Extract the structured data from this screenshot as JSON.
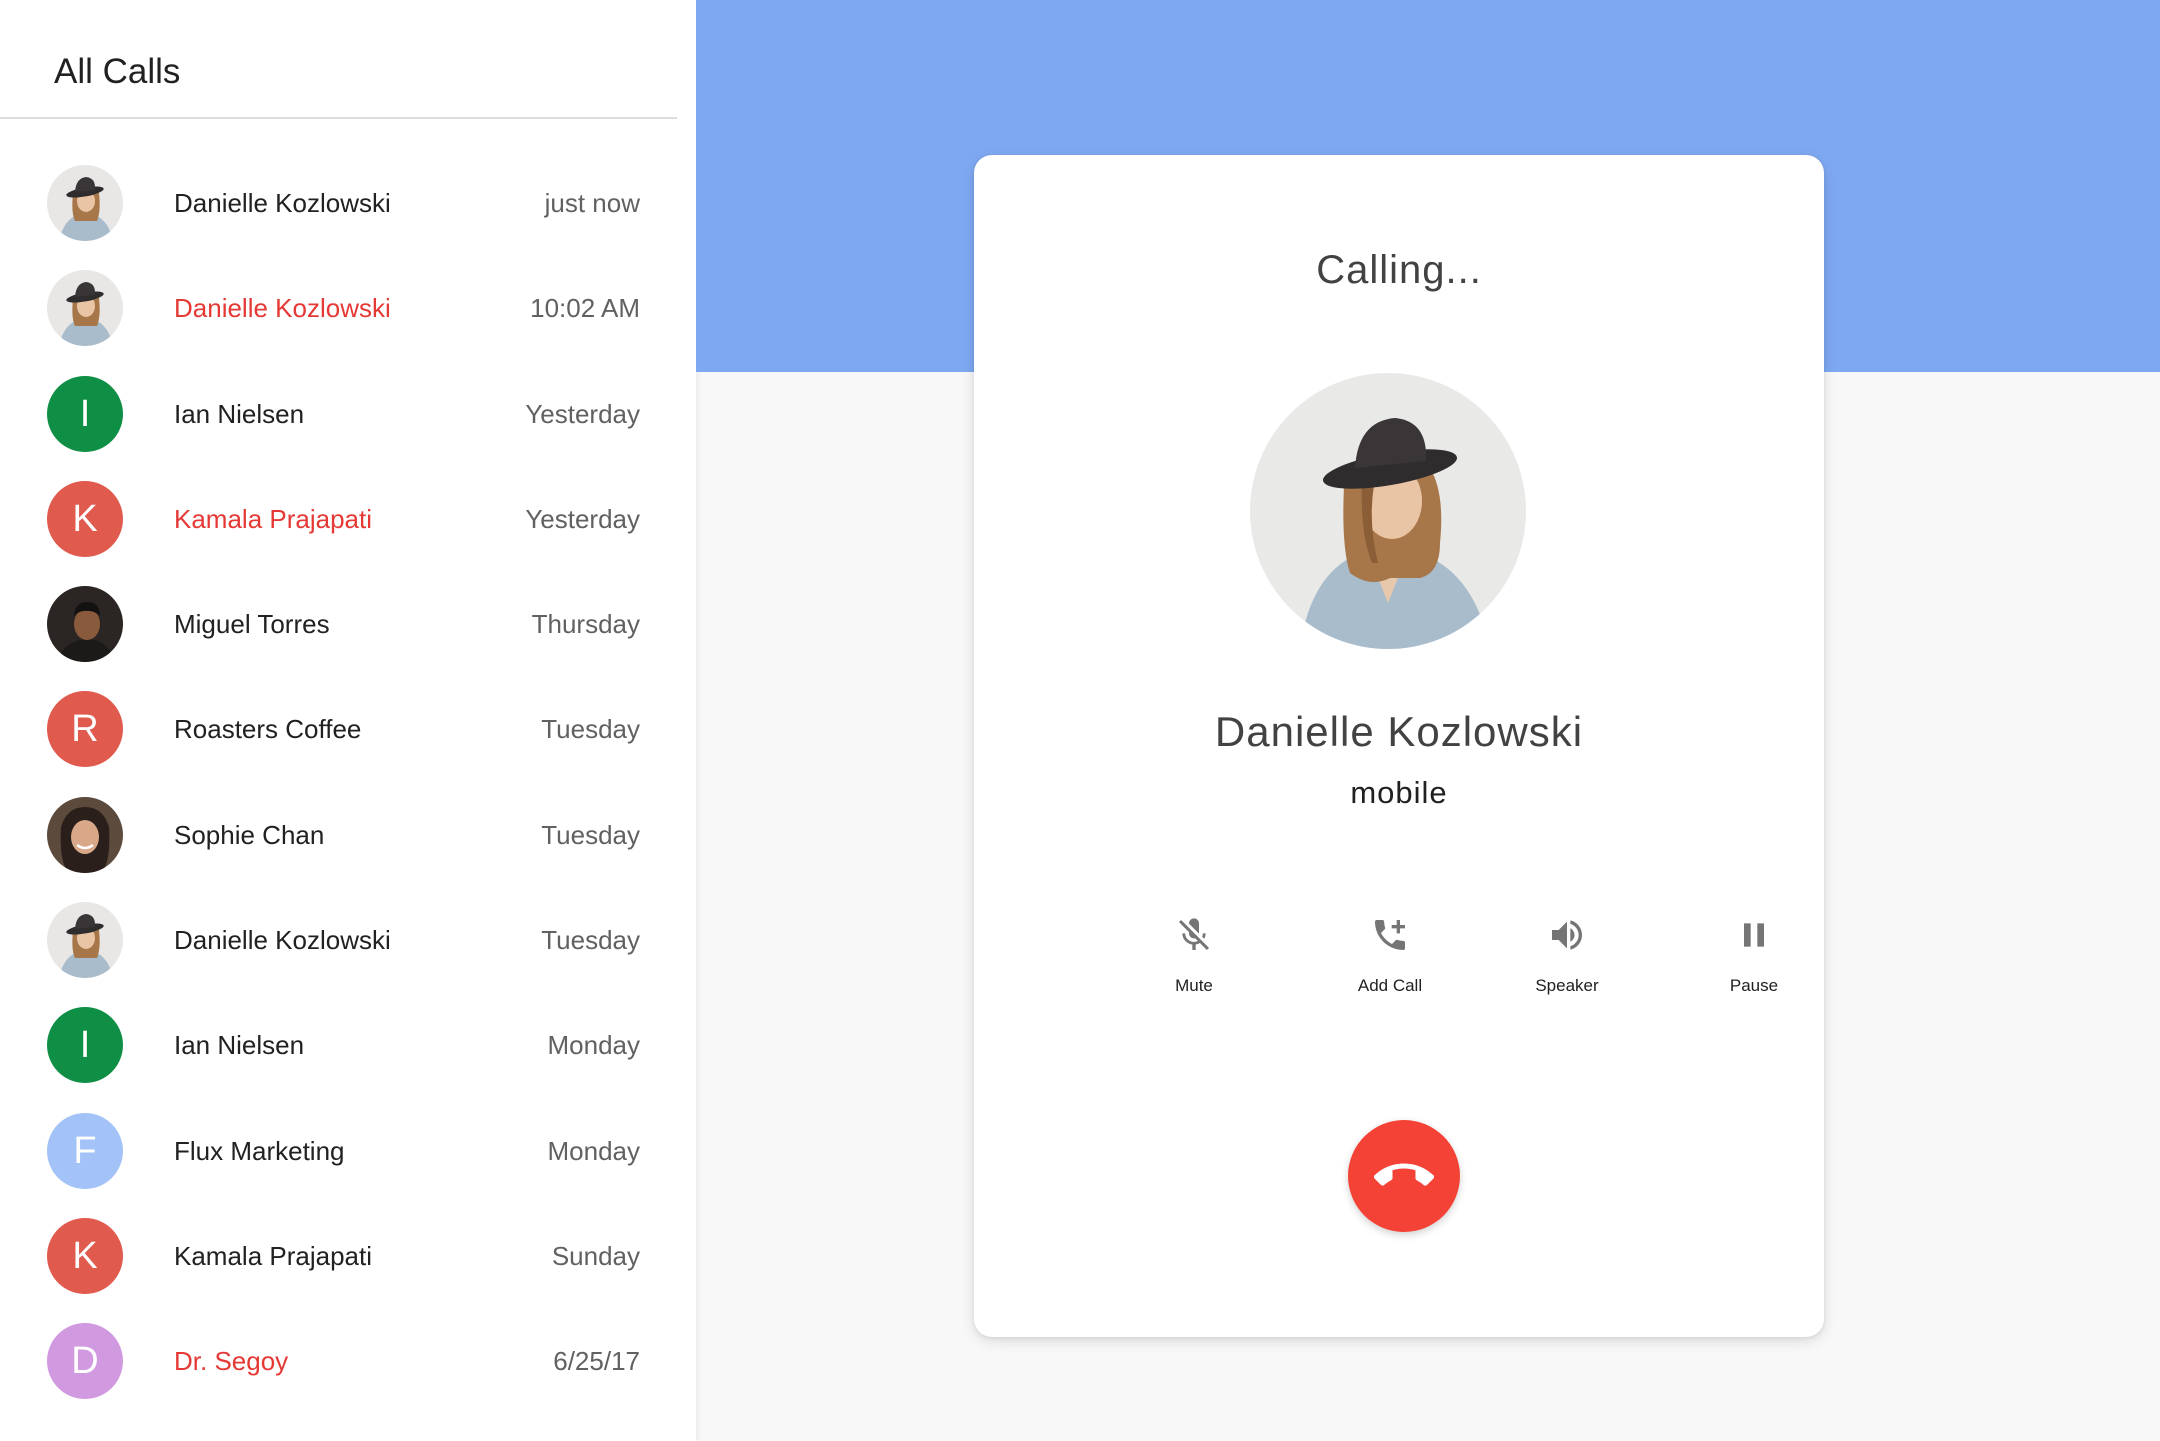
{
  "sidebar": {
    "title": "All Calls",
    "calls": [
      {
        "name": "Danielle Kozlowski",
        "time": "just now",
        "missed": false,
        "avatar": {
          "type": "photo",
          "icon": "danielle-photo"
        }
      },
      {
        "name": "Danielle Kozlowski",
        "time": "10:02 AM",
        "missed": true,
        "avatar": {
          "type": "photo",
          "icon": "danielle-photo"
        }
      },
      {
        "name": "Ian Nielsen",
        "time": "Yesterday",
        "missed": false,
        "avatar": {
          "type": "letter",
          "letter": "I",
          "color": "#0f8f45"
        }
      },
      {
        "name": "Kamala Prajapati",
        "time": "Yesterday",
        "missed": true,
        "avatar": {
          "type": "letter",
          "letter": "K",
          "color": "#e05a4e"
        }
      },
      {
        "name": "Miguel Torres",
        "time": "Thursday",
        "missed": false,
        "avatar": {
          "type": "photo",
          "icon": "miguel-photo"
        }
      },
      {
        "name": "Roasters Coffee",
        "time": "Tuesday",
        "missed": false,
        "avatar": {
          "type": "letter",
          "letter": "R",
          "color": "#e05a4e"
        }
      },
      {
        "name": "Sophie Chan",
        "time": "Tuesday",
        "missed": false,
        "avatar": {
          "type": "photo",
          "icon": "sophie-photo"
        }
      },
      {
        "name": "Danielle Kozlowski",
        "time": "Tuesday",
        "missed": false,
        "avatar": {
          "type": "photo",
          "icon": "danielle-photo"
        }
      },
      {
        "name": "Ian Nielsen",
        "time": "Monday",
        "missed": false,
        "avatar": {
          "type": "letter",
          "letter": "I",
          "color": "#0f8f45"
        }
      },
      {
        "name": "Flux Marketing",
        "time": "Monday",
        "missed": false,
        "avatar": {
          "type": "letter",
          "letter": "F",
          "color": "#a3c2f7"
        }
      },
      {
        "name": "Kamala Prajapati",
        "time": "Sunday",
        "missed": false,
        "avatar": {
          "type": "letter",
          "letter": "K",
          "color": "#e05a4e"
        }
      },
      {
        "name": "Dr. Segoy",
        "time": "6/25/17",
        "missed": true,
        "avatar": {
          "type": "letter",
          "letter": "D",
          "color": "#d19ae0"
        }
      }
    ]
  },
  "call": {
    "status": "Calling...",
    "caller_name": "Danielle Kozlowski",
    "caller_label": "mobile",
    "controls": [
      {
        "label": "Mute",
        "icon": "mic-off-icon"
      },
      {
        "label": "Add Call",
        "icon": "add-call-icon"
      },
      {
        "label": "Speaker",
        "icon": "speaker-icon"
      },
      {
        "label": "Pause",
        "icon": "pause-icon"
      }
    ],
    "end_call_icon": "call-end-icon"
  },
  "colors": {
    "header_band": "#7ea9f2",
    "missed": "#e53935",
    "end_call": "#f44336",
    "background": "#f8f8f8"
  }
}
